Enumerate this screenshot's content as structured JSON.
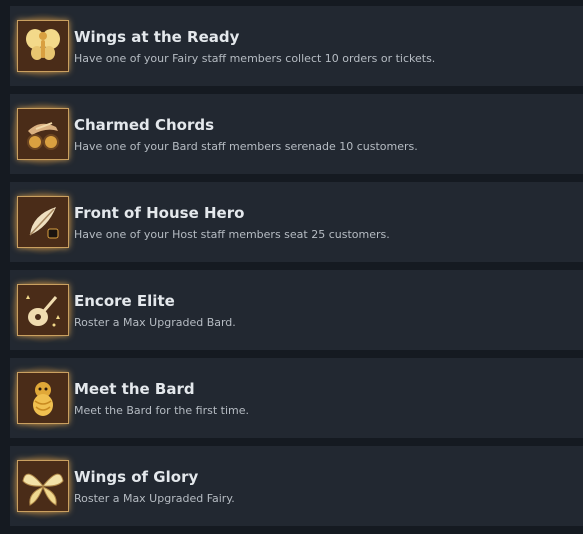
{
  "achievements": [
    {
      "title": "Wings at the Ready",
      "description": "Have one of your Fairy staff members collect 10 orders or tickets.",
      "icon": "fairy-icon"
    },
    {
      "title": "Charmed Chords",
      "description": "Have one of your Bard staff members serenade 10 customers.",
      "icon": "bard-glasses-icon"
    },
    {
      "title": "Front of House Hero",
      "description": "Have one of your Host staff members seat 25 customers.",
      "icon": "quill-ink-icon"
    },
    {
      "title": "Encore Elite",
      "description": "Roster a Max Upgraded Bard.",
      "icon": "lute-icon"
    },
    {
      "title": "Meet the Bard",
      "description": "Meet the Bard for the first time.",
      "icon": "bearded-bard-icon"
    },
    {
      "title": "Wings of Glory",
      "description": "Roster a Max Upgraded Fairy.",
      "icon": "wings-icon"
    }
  ],
  "colors": {
    "background": "#151a21",
    "row": "#222831",
    "title": "#e4e8ec",
    "description": "#b6bcc3",
    "badge_border": "#caa060",
    "badge_fill": "#3d2616",
    "glow": "#ffbe50"
  }
}
